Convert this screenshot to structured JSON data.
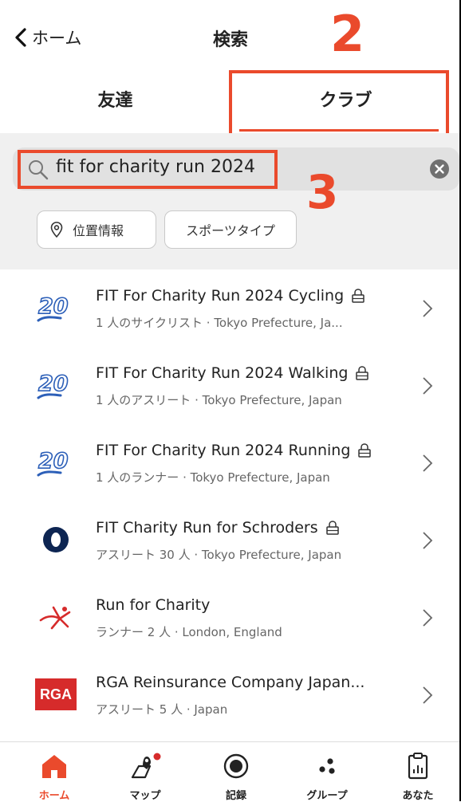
{
  "header": {
    "back_label": "ホーム",
    "title": "検索"
  },
  "annotations": {
    "tab_marker": "2",
    "search_marker": "3"
  },
  "tabs": [
    {
      "label": "友達",
      "active": false
    },
    {
      "label": "クラブ",
      "active": true
    }
  ],
  "search": {
    "value": "fit for charity run 2024",
    "icon": "search-icon",
    "clear_icon": "clear-icon"
  },
  "filters": {
    "location_label": "位置情報",
    "sport_label": "スポーツタイプ"
  },
  "results": [
    {
      "title": "FIT For Charity Run 2024 Cycling",
      "subtitle": "1 人のサイクリスト · Tokyo Prefecture, Ja...",
      "locked": true,
      "logo": "fit-2024-logo"
    },
    {
      "title": "FIT For Charity Run 2024 Walking",
      "subtitle": "1 人のアスリート · Tokyo Prefecture, Japan",
      "locked": true,
      "logo": "fit-2024-logo"
    },
    {
      "title": "FIT For Charity Run 2024 Running",
      "subtitle": "1 人のランナー · Tokyo Prefecture, Japan",
      "locked": true,
      "logo": "fit-2024-logo"
    },
    {
      "title": "FIT Charity Run for Schroders",
      "subtitle": "アスリート 30 人 · Tokyo Prefecture, Japan",
      "locked": true,
      "logo": "schroders-logo"
    },
    {
      "title": "Run for Charity",
      "subtitle": "ランナー 2 人 · London, England",
      "locked": false,
      "logo": "runner-logo"
    },
    {
      "title": "RGA Reinsurance Company Japan...",
      "subtitle": "アスリート 5 人 · Japan",
      "locked": false,
      "logo": "rga-logo",
      "logo_text": "RGA"
    }
  ],
  "bottom_nav": [
    {
      "label": "ホーム",
      "icon": "home-icon",
      "active": true
    },
    {
      "label": "マップ",
      "icon": "map-icon",
      "active": false,
      "badge": true
    },
    {
      "label": "記録",
      "icon": "record-icon",
      "active": false
    },
    {
      "label": "グループ",
      "icon": "groups-icon",
      "active": false
    },
    {
      "label": "あなた",
      "icon": "you-icon",
      "active": false
    }
  ],
  "colors": {
    "accent": "#ea4a2c",
    "logo_blue": "#2c5fb8",
    "schroders_navy": "#0d2552",
    "rga_red": "#d62b2b"
  }
}
